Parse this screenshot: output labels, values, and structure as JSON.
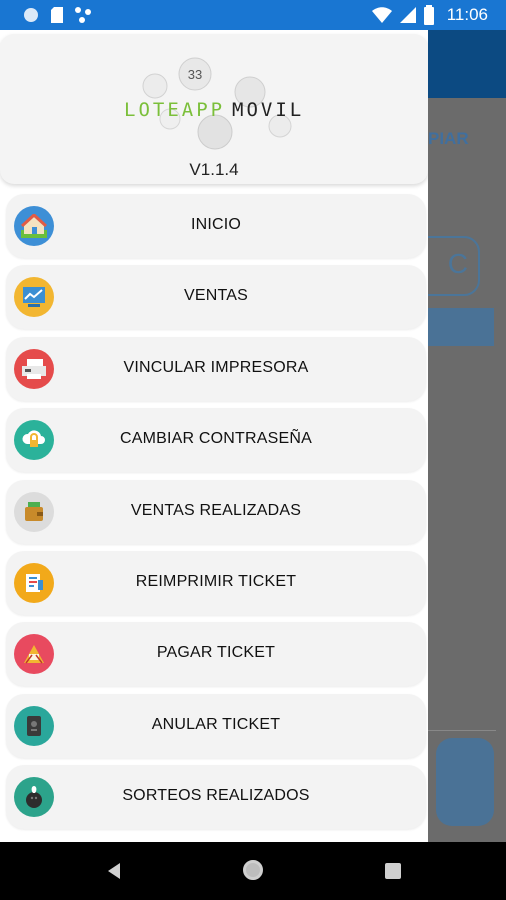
{
  "status_bar": {
    "time": "11:06"
  },
  "app_background": {
    "copy_button_label": "PIAR",
    "input_text": "C"
  },
  "drawer": {
    "logo": {
      "brand_left": "LOTEAPP",
      "brand_right": "MOVIL",
      "ball_number": "33"
    },
    "version": "V1.1.4",
    "menu_items": [
      {
        "label": "INICIO",
        "icon": "house-icon",
        "icon_bg": "#3d8fd6"
      },
      {
        "label": "VENTAS",
        "icon": "sales-chart-icon",
        "icon_bg": "#f2b631"
      },
      {
        "label": "VINCULAR IMPRESORA",
        "icon": "printer-icon",
        "icon_bg": "#e54b4b"
      },
      {
        "label": "CAMBIAR CONTRASEÑA",
        "icon": "cloud-lock-icon",
        "icon_bg": "#2bb29a"
      },
      {
        "label": "VENTAS REALIZADAS",
        "icon": "wallet-icon",
        "icon_bg": "#dcdcdc"
      },
      {
        "label": "REIMPRIMIR TICKET",
        "icon": "ticket-print-icon",
        "icon_bg": "#f2a91a"
      },
      {
        "label": "PAGAR TICKET",
        "icon": "pay-ticket-icon",
        "icon_bg": "#e84a5f"
      },
      {
        "label": "ANULAR TICKET",
        "icon": "void-ticket-icon",
        "icon_bg": "#2aa79b"
      },
      {
        "label": "SORTEOS REALIZADOS",
        "icon": "bowling-icon",
        "icon_bg": "#2ca38b"
      }
    ]
  },
  "nav_bar": {
    "back": "back-icon",
    "home": "home-icon",
    "recents": "recents-icon"
  }
}
